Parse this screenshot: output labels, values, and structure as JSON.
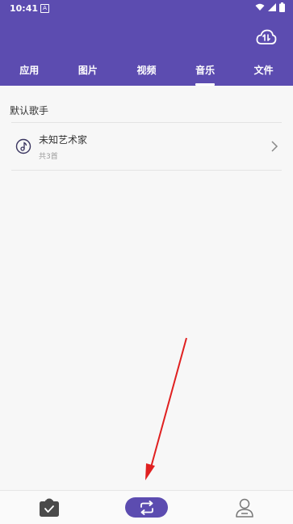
{
  "status_bar": {
    "time": "10:41",
    "notif_icon": "A"
  },
  "header": {
    "transfer_icon": "cloud-transfer-icon",
    "tabs": [
      {
        "label": "应用",
        "active": false
      },
      {
        "label": "图片",
        "active": false
      },
      {
        "label": "视频",
        "active": false
      },
      {
        "label": "音乐",
        "active": true
      },
      {
        "label": "文件",
        "active": false
      }
    ]
  },
  "main": {
    "section_title": "默认歌手",
    "artists": [
      {
        "name": "未知艺术家",
        "count": "共3首"
      }
    ]
  },
  "bottom_nav": {
    "items": [
      {
        "icon": "clipboard-check-icon",
        "active": false
      },
      {
        "icon": "transfer-icon",
        "active": true
      },
      {
        "icon": "profile-icon",
        "active": false
      }
    ]
  },
  "colors": {
    "accent": "#5c4cb0",
    "annotation_arrow": "#e02020"
  }
}
